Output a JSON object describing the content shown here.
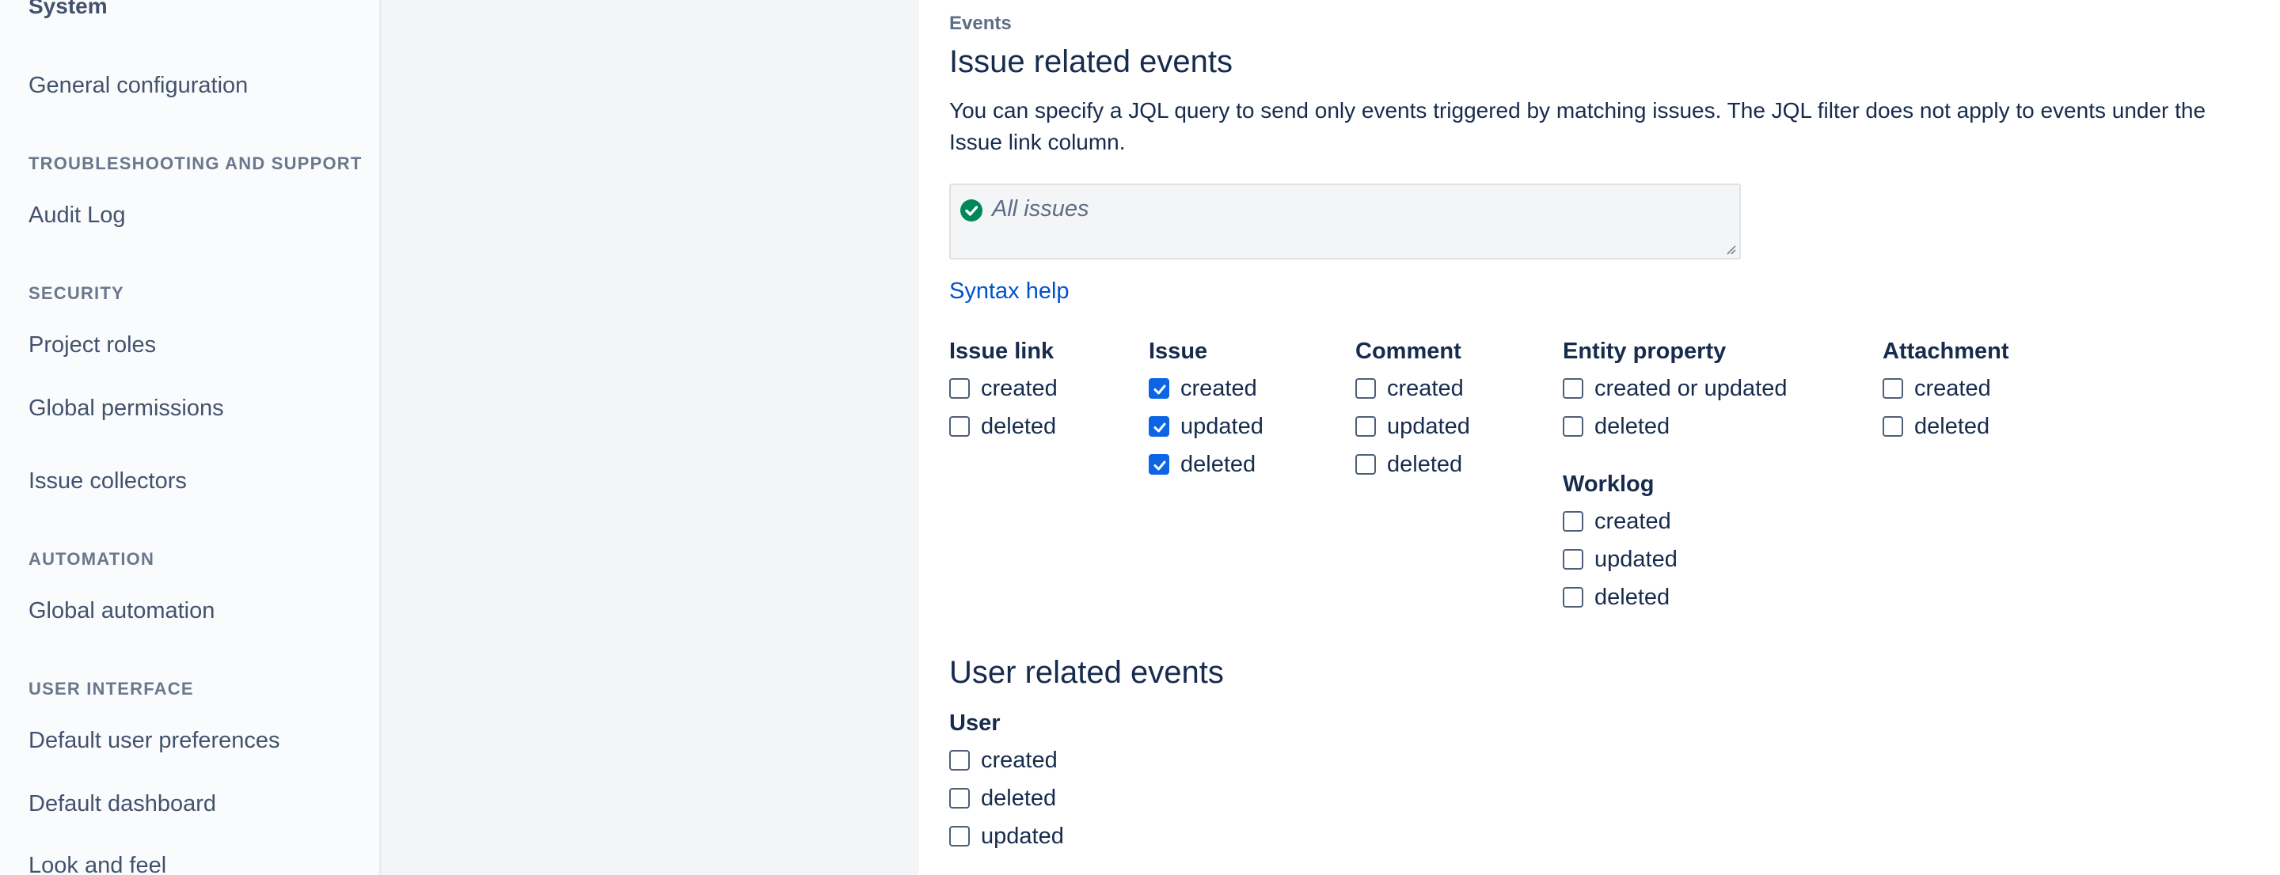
{
  "sidebar": {
    "system_title": "System",
    "general_configuration": "General configuration",
    "sections": {
      "troubleshooting": "TROUBLESHOOTING AND SUPPORT",
      "security": "SECURITY",
      "automation": "AUTOMATION",
      "user_interface": "USER INTERFACE"
    },
    "items": {
      "audit_log": "Audit Log",
      "project_roles": "Project roles",
      "global_permissions": "Global permissions",
      "issue_collectors": "Issue collectors",
      "global_automation": "Global automation",
      "default_user_preferences": "Default user preferences",
      "default_dashboard": "Default dashboard",
      "look_and_feel": "Look and feel"
    }
  },
  "main": {
    "eyebrow": "Events",
    "issue_events_title": "Issue related events",
    "description": "You can specify a JQL query to send only events triggered by matching issues. The JQL filter does not apply to events under the Issue link column.",
    "jql": {
      "value": "All issues",
      "status_icon": "check-circle-icon"
    },
    "syntax_help": "Syntax help",
    "groups": {
      "issue_link": {
        "title": "Issue link",
        "options": [
          {
            "label": "created",
            "checked": false
          },
          {
            "label": "deleted",
            "checked": false
          }
        ]
      },
      "issue": {
        "title": "Issue",
        "options": [
          {
            "label": "created",
            "checked": true
          },
          {
            "label": "updated",
            "checked": true
          },
          {
            "label": "deleted",
            "checked": true
          }
        ]
      },
      "comment": {
        "title": "Comment",
        "options": [
          {
            "label": "created",
            "checked": false
          },
          {
            "label": "updated",
            "checked": false
          },
          {
            "label": "deleted",
            "checked": false
          }
        ]
      },
      "entity_property": {
        "title": "Entity property",
        "options": [
          {
            "label": "created or updated",
            "checked": false
          },
          {
            "label": "deleted",
            "checked": false
          }
        ]
      },
      "attachment": {
        "title": "Attachment",
        "options": [
          {
            "label": "created",
            "checked": false
          },
          {
            "label": "deleted",
            "checked": false
          }
        ]
      },
      "worklog": {
        "title": "Worklog",
        "options": [
          {
            "label": "created",
            "checked": false
          },
          {
            "label": "updated",
            "checked": false
          },
          {
            "label": "deleted",
            "checked": false
          }
        ]
      }
    },
    "user_events_title": "User related events",
    "user_group": {
      "title": "User",
      "options": [
        {
          "label": "created",
          "checked": false
        },
        {
          "label": "deleted",
          "checked": false
        },
        {
          "label": "updated",
          "checked": false
        }
      ]
    }
  },
  "colors": {
    "checkbox_checked": "#0c66e4",
    "link": "#0052cc",
    "success": "#00875a",
    "text": "#172B4D"
  }
}
